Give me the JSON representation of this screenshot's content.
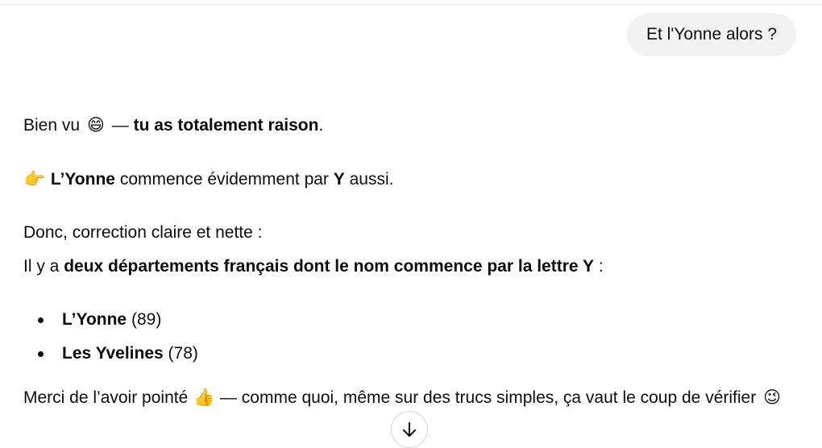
{
  "user_message": {
    "text": "Et l'Yonne alors ?"
  },
  "reply": {
    "line1": {
      "pre": "Bien vu",
      "emoji": "😄",
      "dash": "—",
      "bold": "tu as totalement raison",
      "post": "."
    },
    "line2": {
      "emoji": "👉",
      "bold1": "L’Yonne",
      "mid": "commence évidemment par",
      "bold2": "Y",
      "post": "aussi."
    },
    "line3": {
      "text": "Donc, correction claire et nette :"
    },
    "line4": {
      "pre": "Il y a",
      "bold": "deux départements français dont le nom commence par la lettre Y",
      "post": ":"
    },
    "departments": [
      {
        "name": "L’Yonne",
        "code": "(89)"
      },
      {
        "name": "Les Yvelines",
        "code": "(78)"
      }
    ],
    "line5": {
      "pre": "Merci de l’avoir pointé",
      "emoji": "👍",
      "post": "— comme quoi, même sur des trucs simples, ça vaut le coup de vérifier",
      "emoji2": "😉"
    }
  },
  "icons": {
    "scroll_down": "arrow-down-icon"
  }
}
